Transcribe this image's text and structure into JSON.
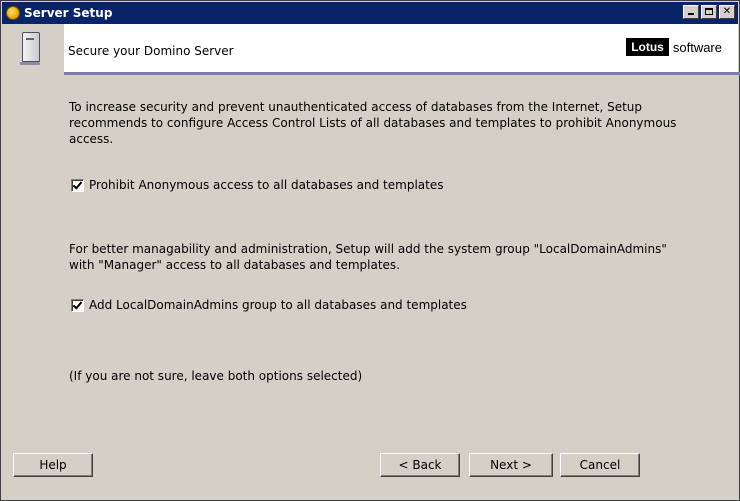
{
  "window": {
    "title": "Server Setup",
    "app_icon": "lotus-icon",
    "controls": [
      "minimize",
      "maximize",
      "close"
    ]
  },
  "header": {
    "icon": "server-icon",
    "title": "Secure your Domino Server",
    "logo_brand": "Lotus",
    "logo_suffix": "software"
  },
  "main": {
    "intro_text": "To increase security and prevent unauthenticated access of databases from the Internet, Setup recommends to configure Access Control Lists of all databases and templates to prohibit Anonymous access.",
    "option1": {
      "label": "Prohibit Anonymous access to all databases and templates",
      "checked": true
    },
    "admin_text": "For better managability and administration, Setup will add the system group \"LocalDomainAdmins\" with \"Manager\" access to all databases and templates.",
    "option2": {
      "label": "Add LocalDomainAdmins group to all databases and templates",
      "checked": true
    },
    "hint": "(If you are not sure, leave both options selected)"
  },
  "footer": {
    "help": "Help",
    "back": "< Back",
    "next": "Next >",
    "cancel": "Cancel"
  }
}
